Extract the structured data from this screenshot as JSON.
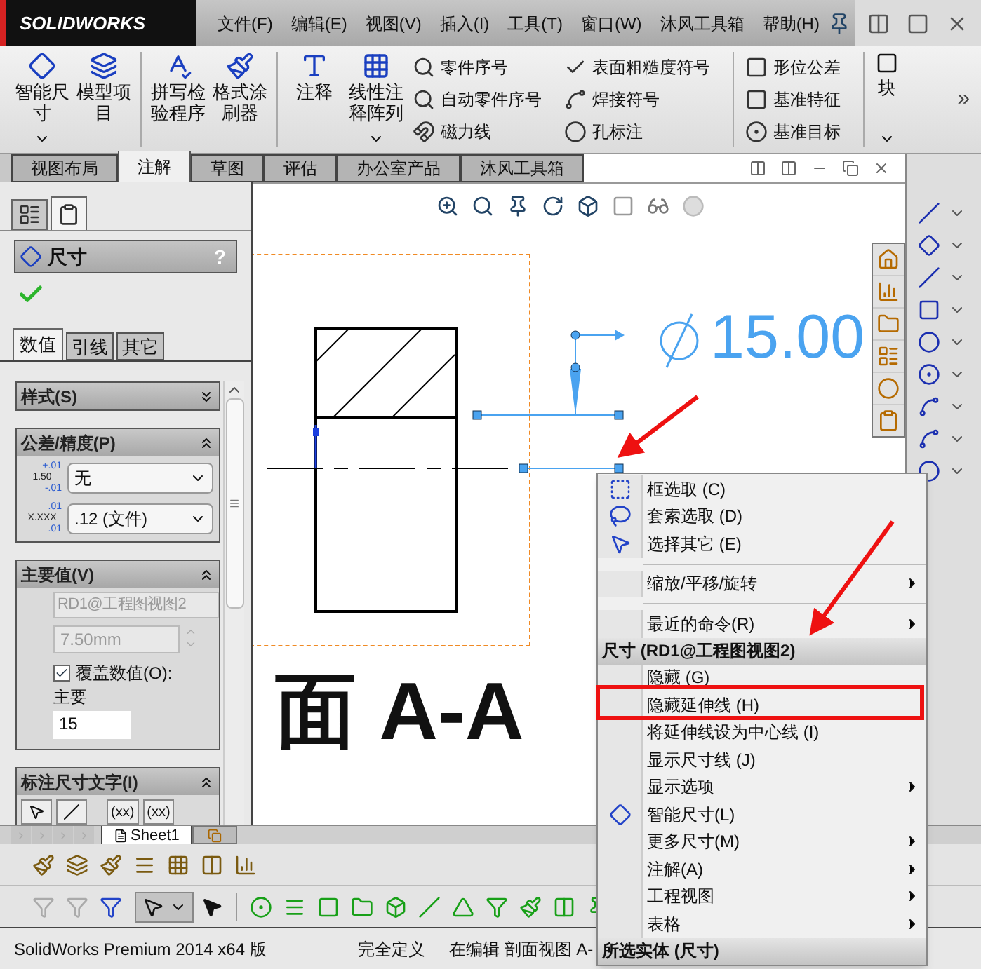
{
  "title_bar": {
    "logo": "SOLIDWORKS",
    "menu": [
      "文件(F)",
      "编辑(E)",
      "视图(V)",
      "插入(I)",
      "工具(T)",
      "窗口(W)",
      "沐风工具箱",
      "帮助(H)"
    ]
  },
  "ribbon": {
    "large": [
      {
        "label": "智能尺寸",
        "dropdown": true
      },
      {
        "label": "模型项目",
        "dropdown": false
      },
      {
        "label": "拼写检验程序",
        "dropdown": false
      },
      {
        "label": "格式涂刷器",
        "dropdown": false
      },
      {
        "label": "注释",
        "dropdown": false
      },
      {
        "label": "线性注释阵列",
        "dropdown": true
      }
    ],
    "small_columns": [
      [
        "零件序号",
        "自动零件序号",
        "磁力线"
      ],
      [
        "表面粗糙度符号",
        "焊接符号",
        "孔标注"
      ],
      [
        "形位公差",
        "基准特征",
        "基准目标"
      ]
    ],
    "block": {
      "label": "块",
      "dropdown": true
    },
    "more": "»"
  },
  "tabs": [
    {
      "label": "视图布局",
      "selected": false
    },
    {
      "label": "注解",
      "selected": true
    },
    {
      "label": "草图",
      "selected": false
    },
    {
      "label": "评估",
      "selected": false
    },
    {
      "label": "办公室产品",
      "selected": false
    },
    {
      "label": "沐风工具箱",
      "selected": false
    }
  ],
  "property_manager": {
    "tabs": [
      {
        "selected": false
      },
      {
        "selected": true
      }
    ],
    "title": "尺寸",
    "help": "?",
    "sub_tabs": [
      {
        "label": "数值",
        "selected": true
      },
      {
        "label": "引线",
        "selected": false
      },
      {
        "label": "其它",
        "selected": false
      }
    ],
    "sections": [
      {
        "kind": "style",
        "title": "样式(S)",
        "expanded": false
      },
      {
        "kind": "tolerance",
        "title": "公差/精度(P)",
        "expanded": true,
        "tolerance_icon": [
          "+.01",
          "1.50",
          "-.01"
        ],
        "tolerance": "无",
        "precision_icon": [
          ".01",
          "X.XXX",
          ".01"
        ],
        "precision": ".12 (文件)"
      },
      {
        "kind": "primary",
        "title": "主要值(V)",
        "expanded": true,
        "reference": "RD1@工程图视图2",
        "value": "7.50mm",
        "override": {
          "label": "覆盖数值(O):",
          "checked": true
        },
        "override_caption": "主要",
        "override_value": "15"
      },
      {
        "kind": "text",
        "title": "标注尺寸文字(I)",
        "expanded": true,
        "buttons": [
          "(xx)",
          "(xx)"
        ]
      }
    ]
  },
  "drawing": {
    "dimension": "15.00",
    "view_label": "面 A-A"
  },
  "sheet_tabs": [
    {
      "label": "Sheet1",
      "selected": true
    }
  ],
  "context_menu": {
    "items": [
      {
        "kind": "item",
        "label": "框选取 (C)",
        "submenu": false
      },
      {
        "kind": "item",
        "label": "套索选取 (D)",
        "submenu": false
      },
      {
        "kind": "item",
        "label": "选择其它 (E)",
        "submenu": false
      },
      {
        "kind": "separator"
      },
      {
        "kind": "item",
        "label": "缩放/平移/旋转",
        "submenu": true
      },
      {
        "kind": "separator"
      },
      {
        "kind": "item",
        "label": "最近的命令(R)",
        "submenu": true
      },
      {
        "kind": "header",
        "label": "尺寸 (RD1@工程图视图2)"
      },
      {
        "kind": "item",
        "label": "隐藏 (G)",
        "submenu": false
      },
      {
        "kind": "item",
        "label": "隐藏延伸线 (H)",
        "submenu": false
      },
      {
        "kind": "item",
        "label": "将延伸线设为中心线 (I)",
        "submenu": false
      },
      {
        "kind": "item",
        "label": "显示尺寸线 (J)",
        "submenu": false
      },
      {
        "kind": "item",
        "label": "显示选项",
        "submenu": true
      },
      {
        "kind": "item",
        "label": "智能尺寸(L)",
        "submenu": false
      },
      {
        "kind": "item",
        "label": "更多尺寸(M)",
        "submenu": true
      },
      {
        "kind": "item",
        "label": "注解(A)",
        "submenu": true
      },
      {
        "kind": "item",
        "label": "工程视图",
        "submenu": true
      },
      {
        "kind": "item",
        "label": "表格",
        "submenu": true
      },
      {
        "kind": "header",
        "label": "所选实体 (尺寸)"
      }
    ]
  },
  "status_bar": [
    "SolidWorks Premium 2014 x64 版",
    "完全定义",
    "在编辑 剖面视图 A-"
  ]
}
